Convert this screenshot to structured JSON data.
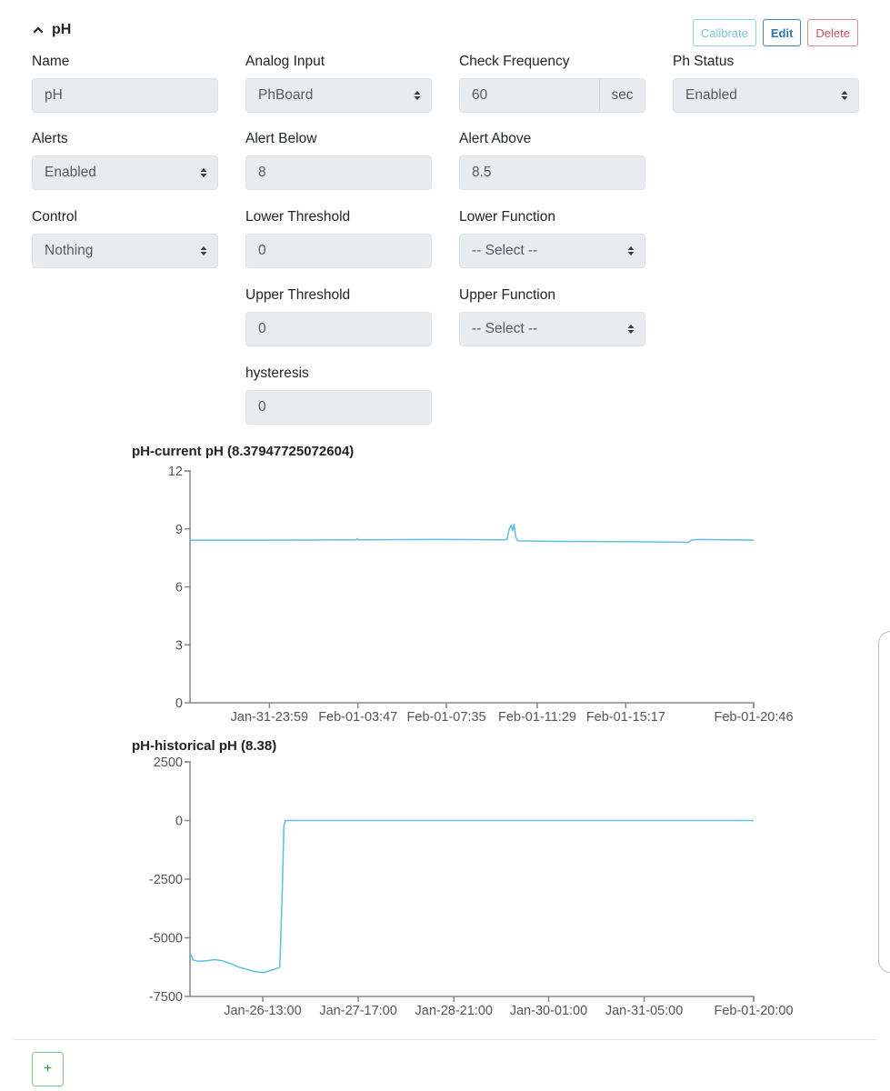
{
  "section": {
    "title": "pH",
    "collapse_icon": "chevron-up-icon",
    "buttons": {
      "calibrate": "Calibrate",
      "edit": "Edit",
      "delete": "Delete"
    }
  },
  "form": {
    "name": {
      "label": "Name",
      "value": "pH"
    },
    "analog_input": {
      "label": "Analog Input",
      "value": "PhBoard"
    },
    "check_frequency": {
      "label": "Check Frequency",
      "value": "60",
      "unit": "sec"
    },
    "ph_status": {
      "label": "Ph Status",
      "value": "Enabled"
    },
    "alerts": {
      "label": "Alerts",
      "value": "Enabled"
    },
    "alert_below": {
      "label": "Alert Below",
      "value": "8"
    },
    "alert_above": {
      "label": "Alert Above",
      "value": "8.5"
    },
    "control": {
      "label": "Control",
      "value": "Nothing"
    },
    "lower_threshold": {
      "label": "Lower Threshold",
      "value": "0"
    },
    "lower_function": {
      "label": "Lower Function",
      "value": "-- Select --"
    },
    "upper_threshold": {
      "label": "Upper Threshold",
      "value": "0"
    },
    "upper_function": {
      "label": "Upper Function",
      "value": "-- Select --"
    },
    "hysteresis": {
      "label": "hysteresis",
      "value": "0"
    }
  },
  "add_button": {
    "label": "+"
  },
  "chart_data": [
    {
      "type": "line",
      "title": "pH-current pH (8.37947725072604)",
      "xlabel": "",
      "ylabel": "",
      "line_color": "#5bc0de",
      "ylim": [
        0,
        12
      ],
      "yticks": [
        0,
        3,
        6,
        9,
        12
      ],
      "x_range_hours": [
        -3.43,
        20.77
      ],
      "xtick_labels": [
        {
          "label": "Jan-31-23:59",
          "hours": -0.02
        },
        {
          "label": "Feb-01-03:47",
          "hours": 3.78
        },
        {
          "label": "Feb-01-07:35",
          "hours": 7.58
        },
        {
          "label": "Feb-01-11:29",
          "hours": 11.48
        },
        {
          "label": "Feb-01-15:17",
          "hours": 15.28
        },
        {
          "label": "Feb-01-20:46",
          "hours": 20.77
        }
      ],
      "series": [
        {
          "name": "pH",
          "points": [
            [
              -3.43,
              8.42
            ],
            [
              0.0,
              8.42
            ],
            [
              3.0,
              8.43
            ],
            [
              3.7,
              8.44
            ],
            [
              3.75,
              8.5
            ],
            [
              3.8,
              8.44
            ],
            [
              7.0,
              8.45
            ],
            [
              10.0,
              8.44
            ],
            [
              10.18,
              8.45
            ],
            [
              10.28,
              9.0
            ],
            [
              10.36,
              9.2
            ],
            [
              10.42,
              8.9
            ],
            [
              10.48,
              9.25
            ],
            [
              10.55,
              8.6
            ],
            [
              10.65,
              8.38
            ],
            [
              12.0,
              8.36
            ],
            [
              15.0,
              8.34
            ],
            [
              17.5,
              8.32
            ],
            [
              17.95,
              8.3
            ],
            [
              18.1,
              8.42
            ],
            [
              18.4,
              8.45
            ],
            [
              20.77,
              8.42
            ]
          ]
        }
      ],
      "x_units": "hours relative to Feb-01-00:00"
    },
    {
      "type": "line",
      "title": "pH-historical pH (8.38)",
      "xlabel": "",
      "ylabel": "",
      "line_color": "#5bc0de",
      "ylim": [
        -7500,
        2500
      ],
      "yticks": [
        -7500,
        -5000,
        -2500,
        0,
        2500
      ],
      "x_range_days": [
        0.0,
        6.9
      ],
      "xtick_labels": [
        {
          "label": "Jan-26-13:00",
          "days": 0.89
        },
        {
          "label": "Jan-27-17:00",
          "days": 2.06
        },
        {
          "label": "Jan-28-21:00",
          "days": 3.23
        },
        {
          "label": "Jan-30-01:00",
          "days": 4.39
        },
        {
          "label": "Jan-31-05:00",
          "days": 5.56
        },
        {
          "label": "Feb-01-20:00",
          "days": 6.9
        }
      ],
      "series": [
        {
          "name": "pH",
          "points": [
            [
              0.0,
              -5650
            ],
            [
              0.04,
              -5950
            ],
            [
              0.1,
              -6000
            ],
            [
              0.2,
              -5980
            ],
            [
              0.3,
              -5930
            ],
            [
              0.4,
              -5980
            ],
            [
              0.5,
              -6100
            ],
            [
              0.6,
              -6250
            ],
            [
              0.7,
              -6350
            ],
            [
              0.8,
              -6450
            ],
            [
              0.9,
              -6480
            ],
            [
              0.98,
              -6400
            ],
            [
              1.07,
              -6300
            ],
            [
              1.1,
              -6250
            ],
            [
              1.13,
              -3000
            ],
            [
              1.15,
              -200
            ],
            [
              1.17,
              0
            ],
            [
              3.0,
              0
            ],
            [
              5.0,
              0
            ],
            [
              6.9,
              0
            ]
          ]
        }
      ],
      "x_units": "days relative to Jan-25-15:40 (approx)"
    }
  ]
}
